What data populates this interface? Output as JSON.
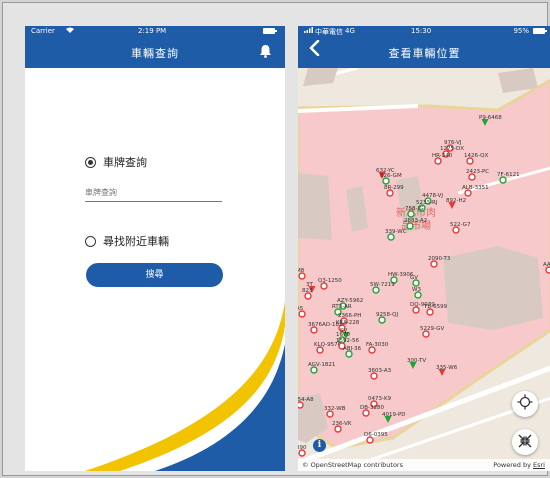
{
  "phone1": {
    "status": {
      "carrier": "Carrier",
      "time": "2:19 PM"
    },
    "title": "車輛查詢",
    "plate_option_label": "車牌查詢",
    "plate_input_placeholder": "車牌查詢",
    "nearby_option_label": "尋找附近車輛",
    "search_button_label": "搜尋",
    "selected_option": "plate",
    "colors": {
      "brand": "#1f5ca8",
      "accent": "#f2c300"
    }
  },
  "phone2": {
    "status": {
      "carrier": "中華電信",
      "network": "4G",
      "time": "15:30",
      "battery": "95%"
    },
    "title": "查看車輛位置",
    "market_label_line1": "新北市肉",
    "market_label_line2": "品市場",
    "attribution_left": "© OpenStreetMap contributors",
    "attribution_prefix": "Powered by",
    "attribution_brand": "Esri",
    "info_label": "i",
    "markers": [
      {
        "label": "P9-6468",
        "color": "green",
        "shape": "pin"
      },
      {
        "label": "976-VJ",
        "color": "red",
        "shape": "ring"
      },
      {
        "label": "1275-DX",
        "color": "red",
        "shape": "ring"
      },
      {
        "label": "HR-340",
        "color": "red",
        "shape": "ring"
      },
      {
        "label": "1426-QX",
        "color": "red",
        "shape": "ring"
      },
      {
        "label": "632-YC",
        "color": "red",
        "shape": "pin"
      },
      {
        "label": "826-GM",
        "color": "green",
        "shape": "ring"
      },
      {
        "label": "2423-PC",
        "color": "red",
        "shape": "ring"
      },
      {
        "label": "7F-6121",
        "color": "green",
        "shape": "ring"
      },
      {
        "label": "8R-299",
        "color": "red",
        "shape": "ring"
      },
      {
        "label": "ALB-3351",
        "color": "red",
        "shape": "ring"
      },
      {
        "label": "4478-VJ",
        "color": "green",
        "shape": "ring"
      },
      {
        "label": "5233-RJ",
        "color": "green",
        "shape": "ring"
      },
      {
        "label": "892-H2",
        "color": "red",
        "shape": "pin"
      },
      {
        "label": "758-JG",
        "color": "green",
        "shape": "ring"
      },
      {
        "label": "2883-A2",
        "color": "green",
        "shape": "ring"
      },
      {
        "label": "339-WC",
        "color": "green",
        "shape": "ring"
      },
      {
        "label": "522-G7",
        "color": "red",
        "shape": "ring"
      },
      {
        "label": "2090-T3",
        "color": "red",
        "shape": "ring"
      },
      {
        "label": "M8",
        "color": "red",
        "shape": "ring"
      },
      {
        "label": "Q3-1250",
        "color": "red",
        "shape": "ring"
      },
      {
        "label": "3T",
        "color": "red",
        "shape": "pin"
      },
      {
        "label": "HW-3906",
        "color": "green",
        "shape": "ring"
      },
      {
        "label": "GV",
        "color": "green",
        "shape": "ring"
      },
      {
        "label": "5W-7219",
        "color": "green",
        "shape": "ring"
      },
      {
        "label": "823",
        "color": "red",
        "shape": "ring"
      },
      {
        "label": "W3",
        "color": "green",
        "shape": "ring"
      },
      {
        "label": "AZY-5962",
        "color": "green",
        "shape": "ring"
      },
      {
        "label": "DQ-9039",
        "color": "red",
        "shape": "ring"
      },
      {
        "label": "TB-6599",
        "color": "red",
        "shape": "ring"
      },
      {
        "label": "A5",
        "color": "red",
        "shape": "ring"
      },
      {
        "label": "RT3-AR",
        "color": "green",
        "shape": "ring"
      },
      {
        "label": "2366-PH",
        "color": "red",
        "shape": "ring"
      },
      {
        "label": "9258-QJ",
        "color": "green",
        "shape": "ring"
      },
      {
        "label": "KEA-228",
        "color": "red",
        "shape": "ring"
      },
      {
        "label": "3676AD-182",
        "color": "red",
        "shape": "ring"
      },
      {
        "label": "SV",
        "color": "green",
        "shape": "pin"
      },
      {
        "label": "1670",
        "color": "green",
        "shape": "ring"
      },
      {
        "label": "5229-GV",
        "color": "red",
        "shape": "ring"
      },
      {
        "label": "KLQ-9576",
        "color": "red",
        "shape": "ring"
      },
      {
        "label": "1592-56",
        "color": "red",
        "shape": "ring"
      },
      {
        "label": "ABJ-36",
        "color": "green",
        "shape": "ring"
      },
      {
        "label": "FA-3030",
        "color": "red",
        "shape": "ring"
      },
      {
        "label": "300-TV",
        "color": "green",
        "shape": "pin"
      },
      {
        "label": "3603-A3",
        "color": "red",
        "shape": "ring"
      },
      {
        "label": "335-W6",
        "color": "red",
        "shape": "pin"
      },
      {
        "label": "AGV-1821",
        "color": "green",
        "shape": "ring"
      },
      {
        "label": "0473-K9",
        "color": "red",
        "shape": "ring"
      },
      {
        "label": "754-A8",
        "color": "red",
        "shape": "ring"
      },
      {
        "label": "332-WB",
        "color": "red",
        "shape": "ring"
      },
      {
        "label": "DB-3280",
        "color": "red",
        "shape": "ring"
      },
      {
        "label": "4019-PD",
        "color": "green",
        "shape": "pin"
      },
      {
        "label": "236-VK",
        "color": "red",
        "shape": "ring"
      },
      {
        "label": "D6-0395",
        "color": "red",
        "shape": "ring"
      },
      {
        "label": "AA",
        "color": "red",
        "shape": "ring"
      },
      {
        "label": "390",
        "color": "red",
        "shape": "ring"
      }
    ]
  }
}
